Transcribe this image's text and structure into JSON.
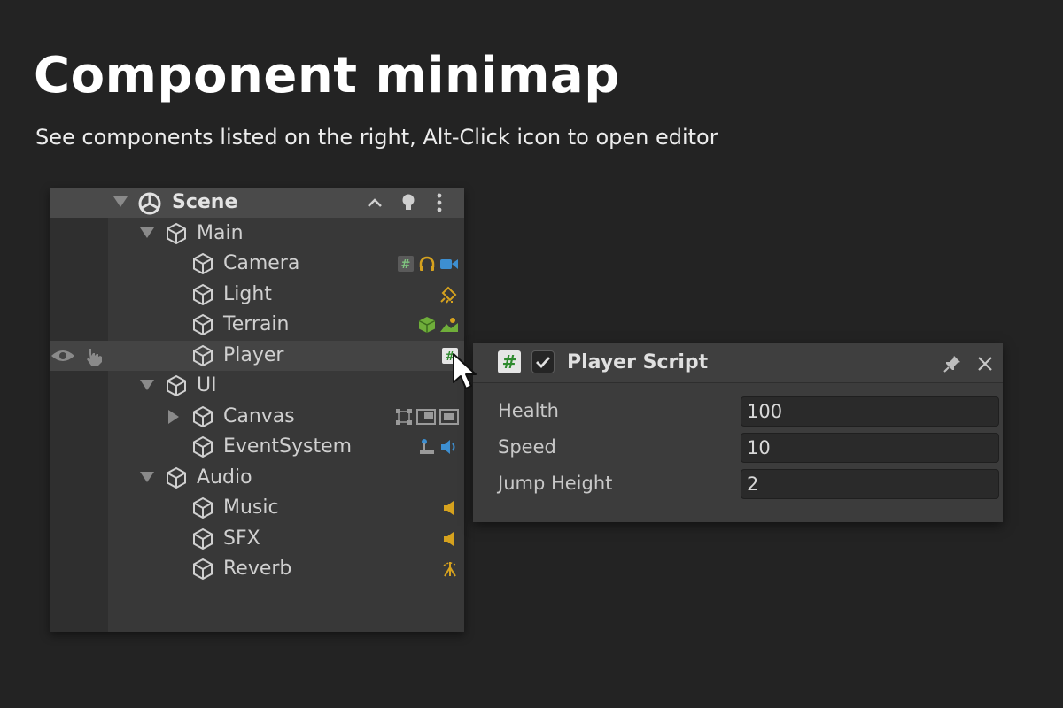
{
  "hero": {
    "title": "Component minimap",
    "subtitle": "See components listed on the right, Alt-Click icon to open editor"
  },
  "hierarchy": {
    "scene_label": "Scene",
    "items": [
      {
        "label": "Main",
        "expanded": true,
        "icons": []
      },
      {
        "label": "Camera",
        "icons": [
          "script-icon",
          "audio-listener-icon",
          "camera-icon"
        ]
      },
      {
        "label": "Light",
        "icons": [
          "light-icon"
        ]
      },
      {
        "label": "Terrain",
        "icons": [
          "terrain-icon",
          "terrain-collider-icon"
        ]
      },
      {
        "label": "Player",
        "icons": [
          "script-icon"
        ]
      },
      {
        "label": "UI",
        "expanded": true,
        "icons": []
      },
      {
        "label": "Canvas",
        "collapsed": true,
        "icons": [
          "rect-transform-icon",
          "canvas-scaler-icon",
          "graphic-raycaster-icon"
        ]
      },
      {
        "label": "EventSystem",
        "icons": [
          "event-system-icon",
          "input-module-icon"
        ]
      },
      {
        "label": "Audio",
        "expanded": true,
        "icons": []
      },
      {
        "label": "Music",
        "icons": [
          "audio-source-icon"
        ]
      },
      {
        "label": "SFX",
        "icons": [
          "audio-source-icon"
        ]
      },
      {
        "label": "Reverb",
        "icons": [
          "reverb-zone-icon"
        ]
      }
    ]
  },
  "inspector": {
    "title": "Player Script",
    "enabled": true,
    "fields": [
      {
        "label": "Health",
        "value": "100"
      },
      {
        "label": "Speed",
        "value": "10"
      },
      {
        "label": "Jump Height",
        "value": "2"
      }
    ]
  },
  "colors": {
    "background": "#232323",
    "panel": "#383838",
    "script_green": "#4caf50",
    "audio_yellow": "#d6a21e",
    "camera_blue": "#3d8fd1"
  }
}
